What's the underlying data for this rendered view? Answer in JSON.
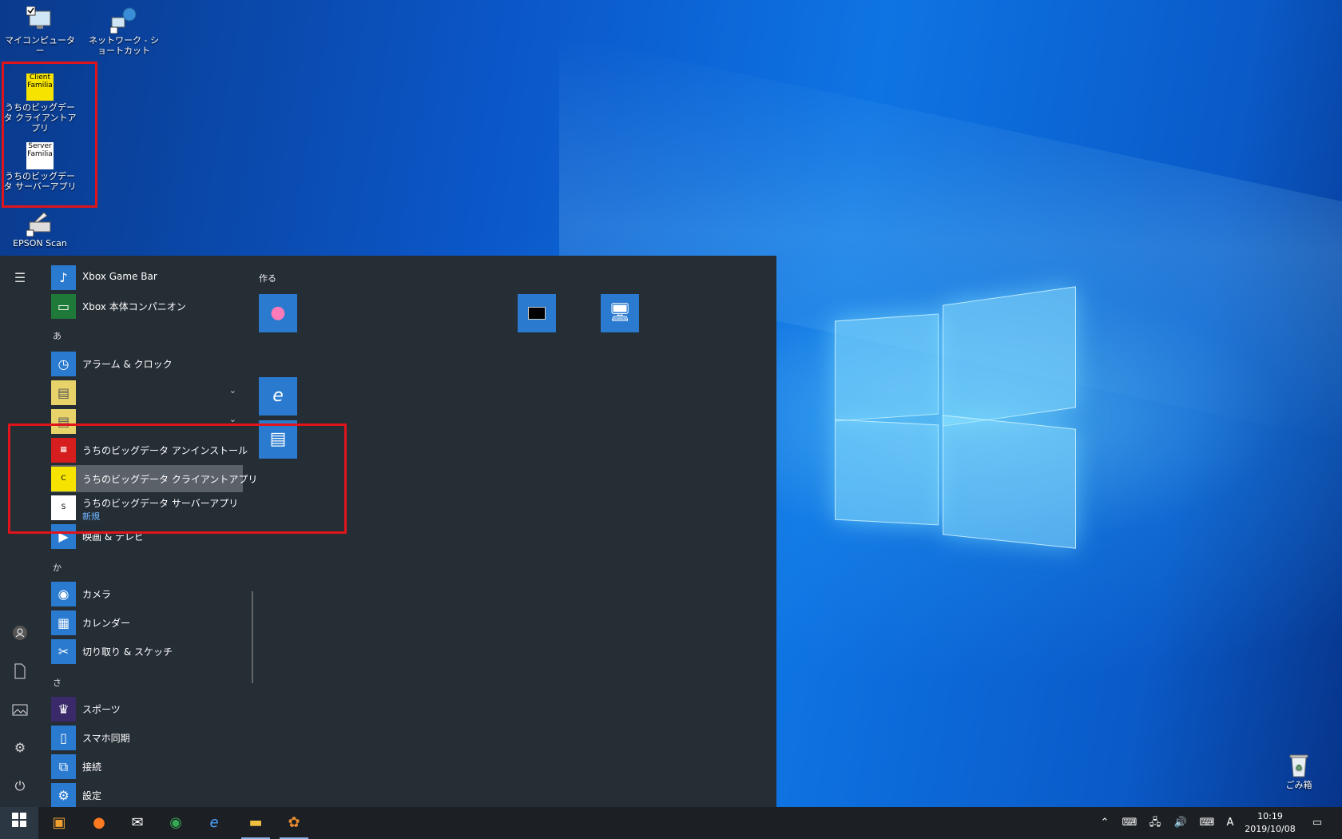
{
  "desktop": {
    "icons": [
      {
        "label": "マイコンピューター",
        "icon": "computer-icon"
      },
      {
        "label": "ネットワーク - ショートカット",
        "icon": "network-shortcut-icon"
      },
      {
        "label": "うちのビッグデータ クライアントアプリ",
        "icon": "client-app-icon",
        "badge": "Client Familia"
      },
      {
        "label": "うちのビッグデータ サーバーアプリ",
        "icon": "server-app-icon",
        "badge": "Server Familia"
      },
      {
        "label": "EPSON Scan",
        "icon": "scanner-icon"
      },
      {
        "label": "ごみ箱",
        "icon": "recycle-bin-icon"
      }
    ]
  },
  "start_menu": {
    "apps_top": [
      {
        "label": "Xbox Game Bar",
        "icon": "xbox-game-bar-icon"
      },
      {
        "label": "Xbox 本体コンパニオン",
        "icon": "xbox-companion-icon"
      }
    ],
    "group_a": "あ",
    "apps_a": [
      {
        "label": "アラーム & クロック",
        "icon": "alarm-clock-icon"
      },
      {
        "label": "うちのビッグデータ アンインストール",
        "icon": "uninstall-icon"
      },
      {
        "label": "うちのビッグデータ クライアントアプリ",
        "icon": "client-app-icon"
      },
      {
        "label": "うちのビッグデータ サーバーアプリ",
        "icon": "server-app-icon",
        "sub": "新規"
      },
      {
        "label": "映画 & テレビ",
        "icon": "movies-tv-icon"
      }
    ],
    "group_ka": "か",
    "apps_ka": [
      {
        "label": "カメラ",
        "icon": "camera-icon"
      },
      {
        "label": "カレンダー",
        "icon": "calendar-icon"
      },
      {
        "label": "切り取り & スケッチ",
        "icon": "snip-sketch-icon"
      }
    ],
    "group_sa": "さ",
    "apps_sa": [
      {
        "label": "スポーツ",
        "icon": "trophy-icon"
      },
      {
        "label": "スマホ同期",
        "icon": "phone-icon"
      },
      {
        "label": "接続",
        "icon": "connect-icon"
      },
      {
        "label": "設定",
        "icon": "gear-icon"
      }
    ],
    "tiles_header": "作る"
  },
  "taskbar": {
    "clock_time": "10:19",
    "clock_date": "2019/10/08",
    "ime": "A"
  }
}
